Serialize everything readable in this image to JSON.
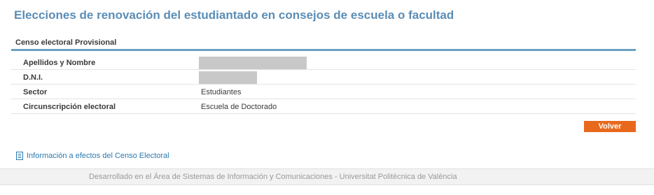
{
  "page": {
    "title": "Elecciones de renovación del estudiantado en consejos de escuela o facultad"
  },
  "section": {
    "title": "Censo electoral Provisional"
  },
  "rows": [
    {
      "label": "Apellidos y Nombre",
      "value": "",
      "redacted": true
    },
    {
      "label": "D.N.I.",
      "value": "",
      "redacted": true
    },
    {
      "label": "Sector",
      "value": "Estudiantes"
    },
    {
      "label": "Circunscripción electoral",
      "value": "Escuela de Doctorado"
    }
  ],
  "actions": {
    "back_label": "Volver"
  },
  "info_link": {
    "icon": "document-icon",
    "label": "Información a efectos del Censo Electoral"
  },
  "footer": {
    "text": "Desarrollado en el Área de Sistemas de Información y Comunicaciones  -  Universitat Politècnica de València"
  },
  "colors": {
    "title": "#5a8db6",
    "accent_rule": "#6b9fc3",
    "button": "#e8691c",
    "link": "#2a7ab0"
  }
}
